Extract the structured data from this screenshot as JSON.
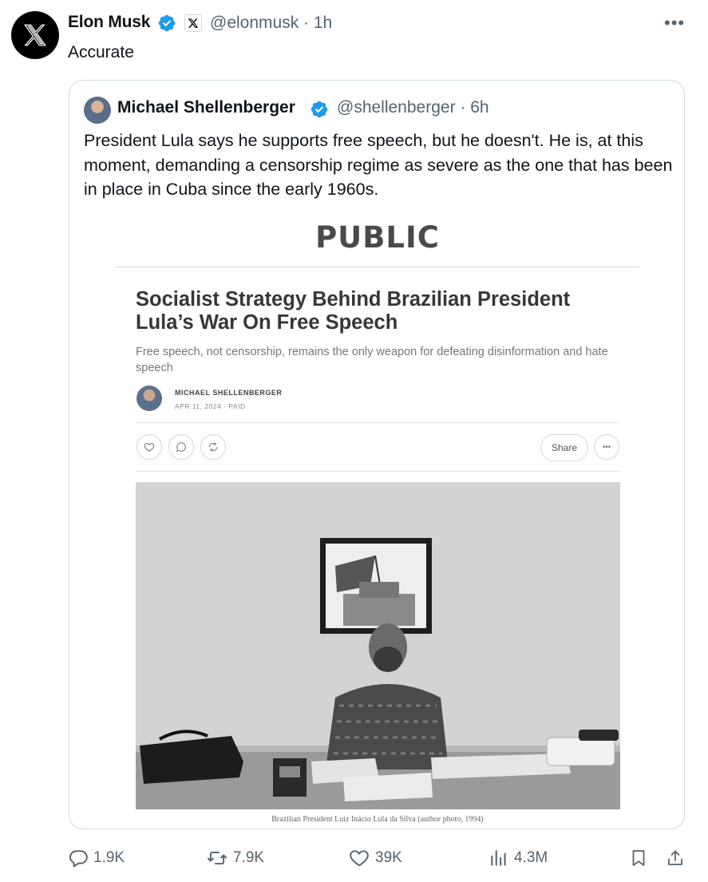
{
  "author": {
    "name": "Elon Musk",
    "handle": "@elonmusk",
    "time": "1h"
  },
  "tweet": {
    "text": "Accurate"
  },
  "quote": {
    "name": "Michael Shellenberger",
    "handle": "@shellenberger",
    "time": "6h",
    "text": "President Lula says he supports free speech, but he doesn't. He is, at this moment, demanding a censorship regime as severe as the one that has been in place in Cuba since the early 1960s."
  },
  "article": {
    "publication": "PUBLIC",
    "title": "Socialist Strategy Behind Brazilian President Lula’s War On Free Speech",
    "subtitle": "Free speech, not censorship, remains the only weapon for defeating disinformation and hate speech",
    "author": "MICHAEL SHELLENBERGER",
    "date": "APR 11, 2024",
    "access": "PAID",
    "share_label": "Share",
    "caption": "Brazilian President Luiz Inácio Lula da Silva (author photo, 1994)"
  },
  "metrics": {
    "replies": "1.9K",
    "reposts": "7.9K",
    "likes": "39K",
    "views": "4.3M"
  },
  "icons": [
    "x-logo-icon",
    "verified-icon",
    "more-icon",
    "reply-icon",
    "repost-icon",
    "like-icon",
    "views-icon",
    "bookmark-icon",
    "share-icon"
  ],
  "colors": {
    "verified": "#1d9bf0",
    "text": "#0f1419",
    "muted": "#536471",
    "border": "#cfd9de"
  }
}
